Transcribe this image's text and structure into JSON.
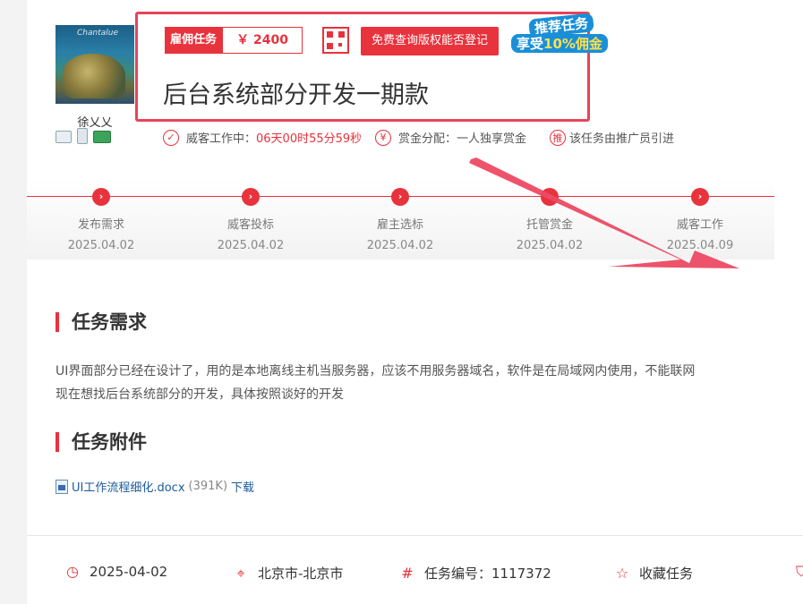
{
  "employer": {
    "name": "徐乂乂",
    "avatar_caption": "Chantalue"
  },
  "task": {
    "type_label": "雇佣任务",
    "price": "￥ 2400",
    "query_button": "免费查询版权能否登记",
    "title": "后台系统部分开发一期款",
    "promo_line1": "推荐任务",
    "promo_line2_prefix": "享受",
    "promo_line2_highlight": "10%佣金"
  },
  "status": {
    "working_label": "威客工作中：",
    "countdown": "06天00时55分59秒",
    "reward_label": "赏金分配：一人独享赏金",
    "referral_prefix": "该任务由",
    "referral_bold": "推广员",
    "referral_suffix": "引进",
    "icon_check": "check-circle-icon",
    "icon_yen": "¥",
    "icon_tui": "推"
  },
  "timeline": [
    {
      "name": "发布需求",
      "date": "2025.04.02"
    },
    {
      "name": "威客投标",
      "date": "2025.04.02"
    },
    {
      "name": "雇主选标",
      "date": "2025.04.02"
    },
    {
      "name": "托管赏金",
      "date": "2025.04.02"
    },
    {
      "name": "威客工作",
      "date": "2025.04.09"
    }
  ],
  "requirements": {
    "title": "任务需求",
    "line1": "UI界面部分已经在设计了，用的是本地离线主机当服务器，应该不用服务器域名，软件是在局域网内使用，不能联网",
    "line2": "现在想找后台系统部分的开发，具体按照谈好的开发"
  },
  "attachments": {
    "title": "任务附件",
    "file_name": "UI工作流程细化.docx",
    "file_size": "(391K)",
    "download": "下载"
  },
  "footer": {
    "date": "2025-04-02",
    "location": "北京市-北京市",
    "task_id": "任务编号：1117372",
    "favorite": "收藏任务"
  },
  "colors": {
    "accent": "#e8323c",
    "highlight_border": "#e8435a",
    "link": "#1a5a9c"
  }
}
